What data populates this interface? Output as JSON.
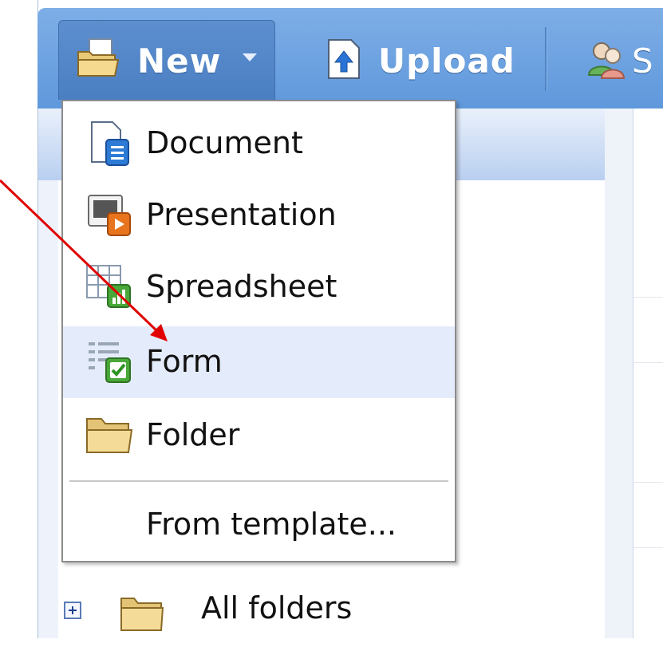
{
  "toolbar": {
    "new_label": "New",
    "upload_label": "Upload",
    "share_label_partial": "S"
  },
  "menu": {
    "items": [
      {
        "label": "Document",
        "icon": "document-icon"
      },
      {
        "label": "Presentation",
        "icon": "presentation-icon"
      },
      {
        "label": "Spreadsheet",
        "icon": "spreadsheet-icon"
      },
      {
        "label": "Form",
        "icon": "form-icon",
        "highlighted": true
      },
      {
        "label": "Folder",
        "icon": "folder-icon"
      }
    ],
    "template_label": "From template..."
  },
  "tree": {
    "all_folders_label": "All folders"
  },
  "colors": {
    "toolbar": "#6fa3e0",
    "highlight": "#e4ecfb",
    "arrow": "#e00000"
  }
}
